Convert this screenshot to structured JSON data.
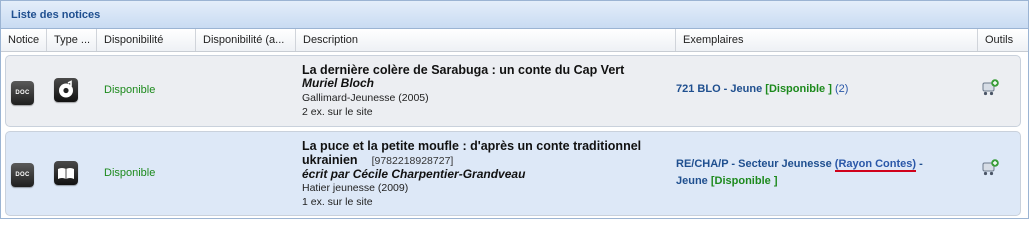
{
  "panel": {
    "title": "Liste des notices"
  },
  "columns": [
    "Notice",
    "Type ...",
    "Disponibilité",
    "Disponibilité (a...",
    "Description",
    "Exemplaires",
    "Outils"
  ],
  "rows": [
    {
      "notice_badge": "DOC",
      "type_icon": "music-disc-icon",
      "availability": "Disponible",
      "title": "La dernière colère de Sarabuga : un conte du Cap Vert",
      "isbn": "",
      "author": "Muriel Bloch",
      "publisher": "Gallimard-Jeunesse (2005)",
      "copies_on_site": "2 ex. sur le site",
      "copies": {
        "call_number": "721 BLO - Jeune",
        "status_open": "[",
        "status": "Disponible",
        "status_close": "]",
        "more": "(2)"
      }
    },
    {
      "notice_badge": "DOC",
      "type_icon": "open-book-icon",
      "availability": "Disponible",
      "title_line1": "La puce et la petite moufle : d'après un conte traditionnel",
      "title_line2": "ukrainien",
      "isbn": "[9782218928727]",
      "author": "écrit par Cécile Charpentier-Grandveau",
      "publisher": "Hatier jeunesse (2009)",
      "copies_on_site": "1 ex. sur le site",
      "copies": {
        "call_number": "RE/CHA/P - Secteur Jeunesse",
        "shelf_open": "(",
        "shelf": "Rayon Contes",
        "shelf_close": ")",
        "dash": "-",
        "section": "Jeune",
        "status_open": "[",
        "status": "Disponible",
        "status_close": "]"
      }
    }
  ],
  "colors": {
    "accent": "#1f4f8f",
    "available": "#1d8a1d",
    "highlight_underline": "#d0021b"
  }
}
